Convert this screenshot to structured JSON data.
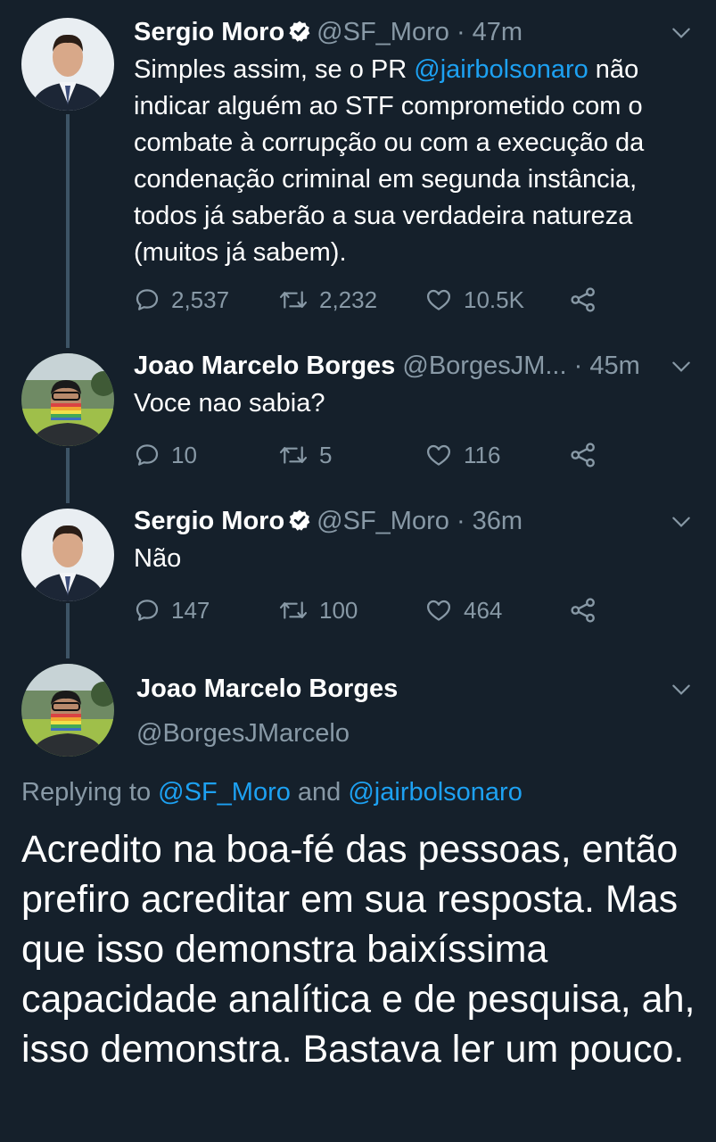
{
  "tweets": [
    {
      "name": "Sergio Moro",
      "handle": "@SF_Moro",
      "sep": "·",
      "time": "47m",
      "text_before": "Simples assim, se o PR ",
      "mention": "@jairbolsonaro",
      "text_after": " não indicar alguém ao STF comprometido com o combate à corrupção ou com a execução da condenação criminal em segunda instância, todos já saberão a sua verdadeira natureza (muitos já sabem).",
      "replies": "2,537",
      "retweets": "2,232",
      "likes": "10.5K",
      "verified": true
    },
    {
      "name": "Joao Marcelo Borges",
      "handle": "@BorgesJM...",
      "sep": "·",
      "time": "45m",
      "text": "Voce nao sabia?",
      "replies": "10",
      "retweets": "5",
      "likes": "116"
    },
    {
      "name": "Sergio Moro",
      "handle": "@SF_Moro",
      "sep": "·",
      "time": "36m",
      "text": "Não",
      "replies": "147",
      "retweets": "100",
      "likes": "464",
      "verified": true
    }
  ],
  "main_tweet": {
    "name": "Joao Marcelo Borges",
    "handle": "@BorgesJMarcelo",
    "replying_prefix": "Replying to ",
    "replying_user1": "@SF_Moro",
    "replying_and": " and ",
    "replying_user2": "@jairbolsonaro",
    "text": "Acredito na boa-fé das pessoas, então prefiro acreditar em sua resposta. Mas que isso demonstra baixíssima capacidade analítica e de pesquisa, ah, isso demonstra. Bastava ler um pouco."
  },
  "colors": {
    "background": "#15202b",
    "text": "#ffffff",
    "muted": "#8899a6",
    "link": "#1da1f2",
    "thread_line": "#3d5466"
  },
  "icons": [
    "verified-badge-icon",
    "chevron-down-icon",
    "reply-icon",
    "retweet-icon",
    "like-icon",
    "share-icon"
  ]
}
